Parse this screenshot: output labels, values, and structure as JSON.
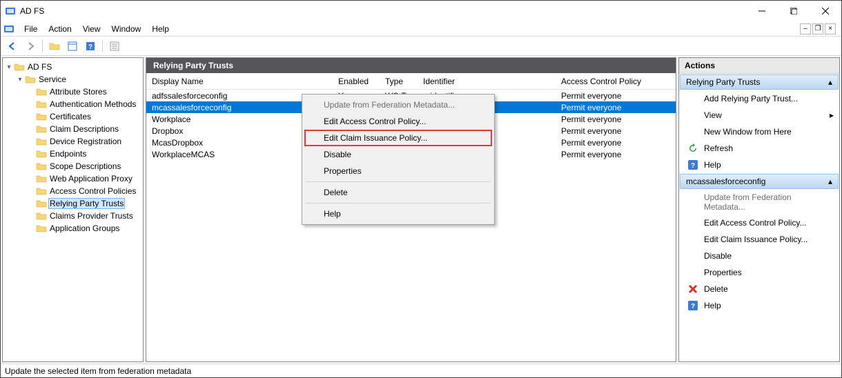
{
  "title": "AD FS",
  "menubar": [
    "File",
    "Action",
    "View",
    "Window",
    "Help"
  ],
  "tree": {
    "root": "AD FS",
    "service": "Service",
    "items": [
      "Attribute Stores",
      "Authentication Methods",
      "Certificates",
      "Claim Descriptions",
      "Device Registration",
      "Endpoints",
      "Scope Descriptions",
      "Web Application Proxy"
    ],
    "lower": [
      "Access Control Policies",
      "Relying Party Trusts",
      "Claims Provider Trusts",
      "Application Groups"
    ]
  },
  "center": {
    "title": "Relying Party Trusts",
    "cols": {
      "name": "Display Name",
      "enabled": "Enabled",
      "type": "Type",
      "identifier": "Identifier",
      "policy": "Access Control Policy"
    },
    "rows": [
      {
        "name": "adfssalesforceconfig",
        "enabled": "Yes",
        "type": "WS-T...",
        "identifier": "< identifier >",
        "policy": "Permit everyone",
        "selected": false
      },
      {
        "name": "mcassalesforceconfig",
        "enabled": "",
        "type": "",
        "identifier": "",
        "policy": "Permit everyone",
        "selected": true
      },
      {
        "name": "Workplace",
        "enabled": "",
        "type": "",
        "identifier": "",
        "policy": "Permit everyone",
        "selected": false
      },
      {
        "name": "Dropbox",
        "enabled": "",
        "type": "",
        "identifier": "",
        "policy": "Permit everyone",
        "selected": false
      },
      {
        "name": "McasDropbox",
        "enabled": "",
        "type": "",
        "identifier": "",
        "policy": "Permit everyone",
        "selected": false
      },
      {
        "name": "WorkplaceMCAS",
        "enabled": "",
        "type": "",
        "identifier": "",
        "policy": "Permit everyone",
        "selected": false
      }
    ]
  },
  "context": {
    "items": [
      {
        "label": "Update from Federation Metadata...",
        "disabled": true
      },
      {
        "label": "Edit Access Control Policy..."
      },
      {
        "label": "Edit Claim Issuance Policy...",
        "highlighted": true
      },
      {
        "label": "Disable"
      },
      {
        "label": "Properties"
      },
      {
        "sep": true
      },
      {
        "label": "Delete"
      },
      {
        "sep": true
      },
      {
        "label": "Help"
      }
    ]
  },
  "actions": {
    "header": "Actions",
    "group1": {
      "title": "Relying Party Trusts",
      "items": [
        {
          "label": "Add Relying Party Trust..."
        },
        {
          "label": "View",
          "arrow": true
        },
        {
          "label": "New Window from Here"
        },
        {
          "label": "Refresh",
          "icon": "refresh"
        },
        {
          "label": "Help",
          "icon": "help"
        }
      ]
    },
    "group2": {
      "title": "mcassalesforceconfig",
      "items": [
        {
          "label": "Update from Federation Metadata...",
          "disabled": true
        },
        {
          "label": "Edit Access Control Policy..."
        },
        {
          "label": "Edit Claim Issuance Policy..."
        },
        {
          "label": "Disable"
        },
        {
          "label": "Properties"
        },
        {
          "label": "Delete",
          "icon": "delete"
        },
        {
          "label": "Help",
          "icon": "help"
        }
      ]
    }
  },
  "statusbar": "Update the selected item from federation metadata"
}
